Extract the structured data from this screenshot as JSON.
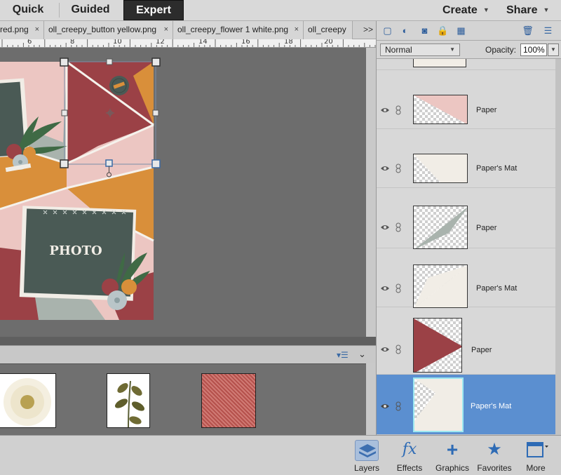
{
  "top_bar": {
    "modes": [
      "Quick",
      "Guided",
      "Expert"
    ],
    "active_mode": "Expert",
    "create_label": "Create",
    "share_label": "Share"
  },
  "doc_tabs": {
    "tabs": [
      "red.png",
      "oll_creepy_button yellow.png",
      "oll_creepy_flower 1 white.png",
      "oll_creepy"
    ],
    "more": ">>"
  },
  "ruler": {
    "marks": [
      "6",
      "8",
      "10",
      "12",
      "14",
      "16",
      "18",
      "20"
    ]
  },
  "canvas": {
    "photo_label": "PHOTO"
  },
  "layers_panel": {
    "blend_mode": "Normal",
    "opacity_label": "Opacity:",
    "opacity_value": "100%",
    "layers": [
      {
        "name": "Paper",
        "shape": "pink-triangle"
      },
      {
        "name": "Paper's Mat",
        "shape": "cream-triangle"
      },
      {
        "name": "Paper",
        "shape": "sage-triangle"
      },
      {
        "name": "Paper's Mat",
        "shape": "cream-wedge"
      },
      {
        "name": "Paper",
        "shape": "red-triangle"
      },
      {
        "name": "Paper's Mat",
        "shape": "cream-triangle",
        "selected": true
      }
    ]
  },
  "bottom_bar": {
    "layers_label": "Layers",
    "effects_label": "Effects",
    "graphics_label": "Graphics",
    "favorites_label": "Favorites",
    "more_label": "More"
  },
  "colors": {
    "red": "#9b4146",
    "pink": "#ecc6c2",
    "sage": "#a9b3ad",
    "orange": "#d98f3a",
    "dark_teal": "#4a5a55",
    "cream": "#f1ede6",
    "selected_row": "#5b8fd0"
  }
}
